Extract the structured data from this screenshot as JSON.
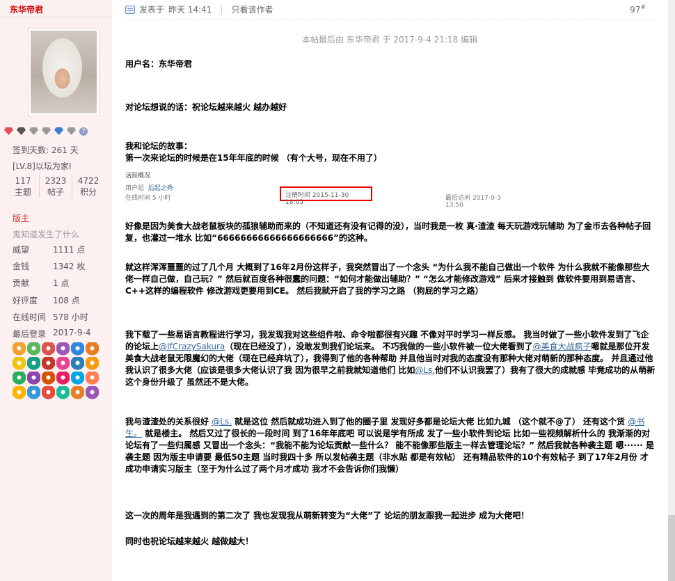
{
  "profile": {
    "username": "东华帝君",
    "checkin": "签到天数: 261 天",
    "level": "[LV.8]以坛为家I",
    "stats": [
      {
        "value": "117",
        "label": "主题"
      },
      {
        "value": "2323",
        "label": "帖子"
      },
      {
        "value": "4722",
        "label": "积分"
      }
    ],
    "role": "版主",
    "signature": "鬼知道发生了什么",
    "info": [
      {
        "k": "威望",
        "v": "1111 点"
      },
      {
        "k": "金钱",
        "v": "1342 枚"
      },
      {
        "k": "贡献",
        "v": "1 点"
      },
      {
        "k": "好评度",
        "v": "108 点"
      },
      {
        "k": "在线时间",
        "v": "578 小时"
      },
      {
        "k": "最后登录",
        "v": "2017-9-4"
      }
    ],
    "gem_colors": [
      "#e05050",
      "#555555",
      "#999999",
      "#999999",
      "#3a7fd0",
      "#999999"
    ],
    "medal_colors": [
      "#f2a02e",
      "#5cb85c",
      "#d9534f",
      "#9b59b6",
      "#2e86de",
      "#e67e22",
      "#f1c40f",
      "#16a085",
      "#c0392b",
      "#e84393",
      "#2980b9",
      "#f39c12",
      "#27ae60",
      "#8e44ad",
      "#d35400",
      "#e91e63",
      "#00a8e8",
      "#ff7f50",
      "#ffb400",
      "#3498db",
      "#e74c3c",
      "#1abc9c",
      "#e67e22",
      "#9b59b6"
    ]
  },
  "post": {
    "meta_posted": "发表于",
    "meta_time": "昨天 14:41",
    "only_author": "只看该作者",
    "floor": "97",
    "floor_sup": "#",
    "edited": "本帖最后由 东华帝君 于 2017-9-4 21:18 编辑",
    "username_line": "用户名：东华帝君",
    "talk_line": "对论坛想说的话：祝论坛越来越火  越办越好",
    "story_title": "我和论坛的故事：",
    "story_first": "第一次来论坛的时候是在15年年底的时候  （有个大号，现在不用了）",
    "embed": {
      "title": "活跃概况",
      "user_label": "用户组",
      "user_value": "后起之秀",
      "online": "在线时间  5 小时",
      "register": "注册时间  2015-11-30 18:05",
      "last_visit": "最后访问  2017-9-3 13:50"
    },
    "p1": "好像是因为美食大战老鼠板块的孤狼辅助而来的（不知道还有没有记得的没），当时我是一枚  真·渣渣  每天玩游戏玩辅助      为了金币去各种帖子回复，也灌过一堆水       比如“66666666666666666666”的这种。",
    "p2": "就这样浑浑噩噩的过了几个月       大概到了16年2月份这样子，我突然冒出了一个念头  “为什么我不能自己做出一个软件  为什么我就不能像那些大佬一样自己做，自己玩？”       然后就百度各种很蠢的问题：“如何才能做出辅助？”   “怎么才能修改游戏”        后来才接触到  做软件要用到易语言、C++这样的编程软件  修改游戏更要用到CE。 然后我就开启了我的学习之路        （狗屁的学习之路）",
    "p3a": "我下载了一些易语言教程进行学习，我发现我对这些组件啦、命令啦都很有兴趣  不像对平时学习一样反感。  我当时做了一些小软件发到了飞企的论坛上",
    "p3link1": "@IfCrazySakura",
    "p3b": "（现在已经没了），没敢发到我们论坛来。       不巧我做的一些小软件被一位大佬看到了",
    "p3link2": "@美食大战疯子",
    "p3c": "嗯就是那位开发美食大战老鼠无限魔幻的大佬（现在已经弃坑了），我得到了他的各种帮助  并且他当时对我的态度没有那种大佬对萌新的那种态度。  并且通过他我认识了很多大佬（应该是很多大佬认识了我  因为很早之前我就知道他们  比如",
    "p3link3": "@Ls.",
    "p3d": "他们不认识我罢了）我有了很大的成就感  毕竟成功的从萌新这个身份升级了  虽然还不是大佬。",
    "p4a": "我与渣渣处的关系很好  ",
    "p4link1": "@Ls.",
    "p4b": "        就是这位  然后就成功进入到了他的圈子里        发现好多都是论坛大佬  比如九城  （这个就不@了）       还有这个货 ",
    "p4link2": "@书生。",
    "p4c": "         就是楼主。       然后又过了很长的一段时间        到了16年年底吧  可以说是学有所成        发了一些小软件到论坛  比如一些视频解析什么的         我渐渐的对论坛有了一些归属感       又冒出一个念头：“我能不能为论坛贡献一些什么？     能不能像那些版主一样去管理论坛？”         然后我就各种袭主题        嗯······  是袭主题        因为版主申请要  最低50主题      当时我四十多       所以发帖袭主题（非水贴  都是有效帖）        还有精品软件的10个有效帖子        到了17年2月份  才成功申请实习版主（至于为什么过了两个月才成功  我才不会告诉你们我懒）",
    "p5": "这一次的周年是我遇到的第二次了        我也发现我从萌新转变为“大佬”了          论坛的朋友跟我一起进步  成为大佬吧！",
    "p6": "同时也祝论坛越来越火  越做越大！"
  }
}
